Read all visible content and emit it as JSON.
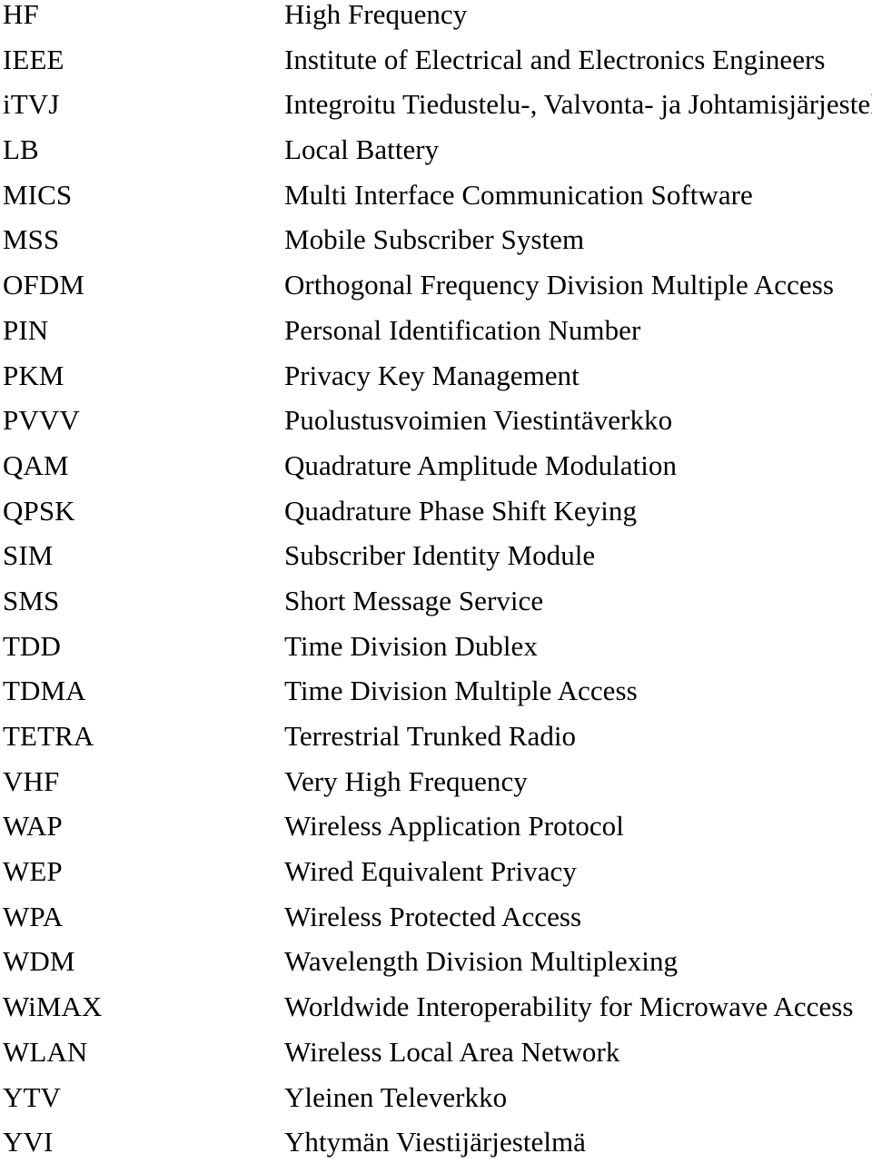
{
  "document": {
    "type": "abbreviations-glossary",
    "background_color": "#ffffff",
    "text_color": "#000000",
    "columns": {
      "abbreviation_header": "",
      "expansion_header": ""
    }
  },
  "entries": [
    {
      "abbr": "HF",
      "expansion": "High Frequency"
    },
    {
      "abbr": "IEEE",
      "expansion": "Institute of Electrical and Electronics Engineers"
    },
    {
      "abbr": "iTVJ",
      "expansion": "Integroitu Tiedustelu-, Valvonta- ja Johtamisjärjestelmä"
    },
    {
      "abbr": "LB",
      "expansion": "Local Battery"
    },
    {
      "abbr": "MICS",
      "expansion": "Multi Interface Communication Software"
    },
    {
      "abbr": "MSS",
      "expansion": "Mobile Subscriber System"
    },
    {
      "abbr": "OFDM",
      "expansion": "Orthogonal Frequency Division Multiple Access"
    },
    {
      "abbr": "PIN",
      "expansion": "Personal Identification Number"
    },
    {
      "abbr": "PKM",
      "expansion": "Privacy Key Management"
    },
    {
      "abbr": "PVVV",
      "expansion": "Puolustusvoimien Viestintäverkko"
    },
    {
      "abbr": "QAM",
      "expansion": "Quadrature Amplitude Modulation"
    },
    {
      "abbr": "QPSK",
      "expansion": "Quadrature Phase Shift Keying"
    },
    {
      "abbr": "SIM",
      "expansion": "Subscriber Identity Module"
    },
    {
      "abbr": "SMS",
      "expansion": "Short Message Service"
    },
    {
      "abbr": "TDD",
      "expansion": "Time Division Dublex"
    },
    {
      "abbr": "TDMA",
      "expansion": "Time Division Multiple Access"
    },
    {
      "abbr": "TETRA",
      "expansion": "Terrestrial Trunked Radio"
    },
    {
      "abbr": "VHF",
      "expansion": "Very High Frequency"
    },
    {
      "abbr": "WAP",
      "expansion": "Wireless Application Protocol"
    },
    {
      "abbr": "WEP",
      "expansion": "Wired Equivalent Privacy"
    },
    {
      "abbr": "WPA",
      "expansion": "Wireless Protected Access"
    },
    {
      "abbr": "WDM",
      "expansion": "Wavelength Division Multiplexing"
    },
    {
      "abbr": "WiMAX",
      "expansion": "Worldwide Interoperability for Microwave Access"
    },
    {
      "abbr": "WLAN",
      "expansion": "Wireless Local Area Network"
    },
    {
      "abbr": "YTV",
      "expansion": "Yleinen Televerkko"
    },
    {
      "abbr": "YVI",
      "expansion": "Yhtymän Viestijärjestelmä"
    }
  ]
}
